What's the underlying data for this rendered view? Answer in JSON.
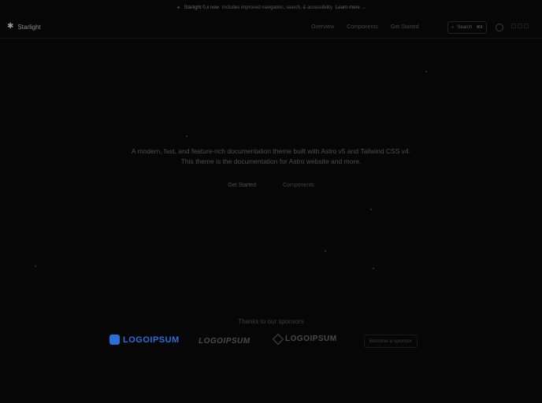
{
  "announcement": {
    "badge": "Starlight 0.x now",
    "text": "Includes improved navigation, search, & accessibility",
    "link": "Learn more →"
  },
  "nav": {
    "brand": "Starlight",
    "links": [
      "Overview",
      "Components",
      "Get Started"
    ],
    "search_label": "Search",
    "search_kbd": "⌘K"
  },
  "hero": {
    "description": "A modern, fast, and feature-rich documentation theme built with Astro v5 and Tailwind CSS v4. This theme is the documentation for Astro website and more.",
    "primary_button": "Get Started",
    "secondary_button": "Components"
  },
  "sponsors": {
    "title": "Thanks to our sponsors",
    "logos": [
      "LOGOIPSUM",
      "LOGOIPSUM",
      "LOGOIPSUM"
    ],
    "become_sponsor": "Become a sponsor"
  },
  "colors": {
    "background": "#060606",
    "sponsor_accent": "#2b6fd6"
  }
}
